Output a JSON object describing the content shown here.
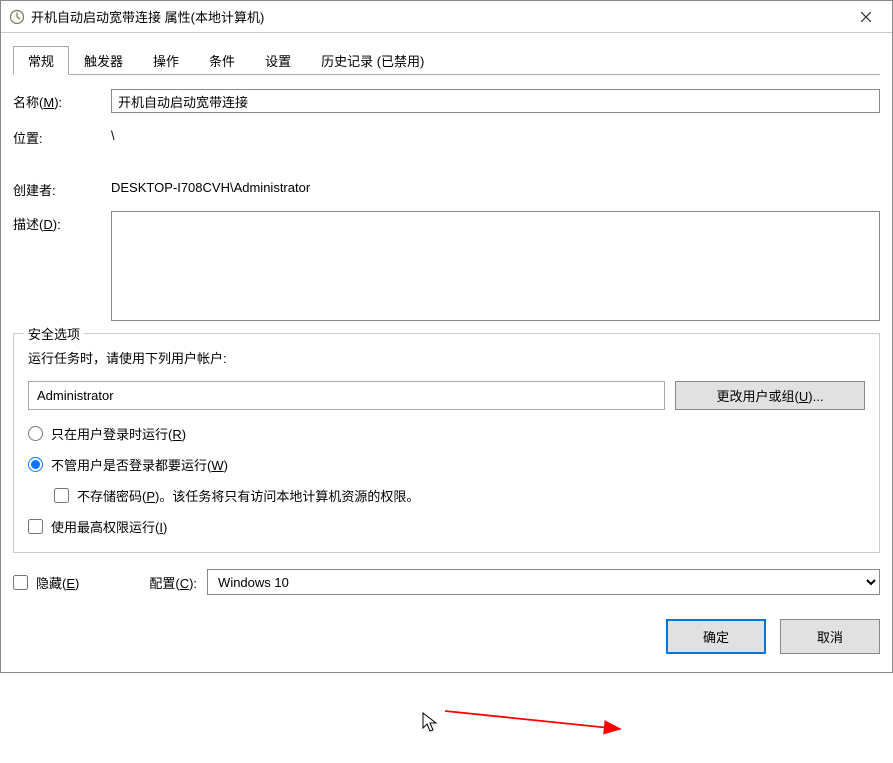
{
  "window": {
    "title": "开机自动启动宽带连接 属性(本地计算机)"
  },
  "tabs": [
    {
      "label": "常规",
      "active": true
    },
    {
      "label": "触发器",
      "active": false
    },
    {
      "label": "操作",
      "active": false
    },
    {
      "label": "条件",
      "active": false
    },
    {
      "label": "设置",
      "active": false
    },
    {
      "label": "历史记录 (已禁用)",
      "active": false
    }
  ],
  "general": {
    "name_label_prefix": "名称(",
    "name_key": "M",
    "name_label_suffix": "):",
    "name_value": "开机自动启动宽带连接",
    "location_label": "位置:",
    "location_value": "\\",
    "creator_label": "创建者:",
    "creator_value": "DESKTOP-I708CVH\\Administrator",
    "desc_label_prefix": "描述(",
    "desc_key": "D",
    "desc_label_suffix": "):",
    "desc_value": ""
  },
  "security": {
    "group_title": "安全选项",
    "run_as_label": "运行任务时，请使用下列用户帐户:",
    "account": "Administrator",
    "change_user_btn_prefix": "更改用户或组(",
    "change_user_key": "U",
    "change_user_btn_suffix": ")...",
    "radio_logged_prefix": "只在用户登录时运行(",
    "radio_logged_key": "R",
    "radio_logged_suffix": ")",
    "radio_always_prefix": "不管用户是否登录都要运行(",
    "radio_always_key": "W",
    "radio_always_suffix": ")",
    "nopass_prefix": "不存储密码(",
    "nopass_key": "P",
    "nopass_suffix": ")。该任务将只有访问本地计算机资源的权限。",
    "highest_prefix": "使用最高权限运行(",
    "highest_key": "I",
    "highest_suffix": ")",
    "radio_selected": "always",
    "nopass_checked": false,
    "highest_checked": false
  },
  "bottom": {
    "hidden_prefix": "隐藏(",
    "hidden_key": "E",
    "hidden_suffix": ")",
    "hidden_checked": false,
    "config_label_prefix": "配置(",
    "config_key": "C",
    "config_label_suffix": "):",
    "config_value": "Windows 10"
  },
  "footer": {
    "ok": "确定",
    "cancel": "取消"
  }
}
